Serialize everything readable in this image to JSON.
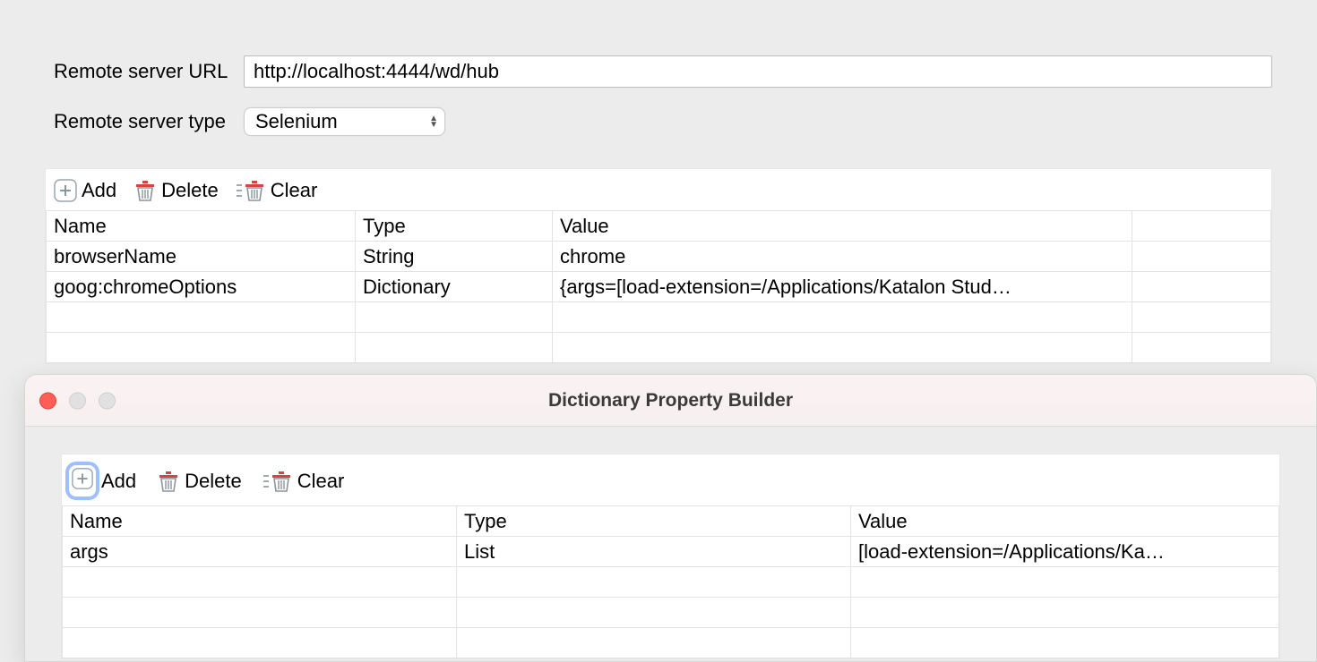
{
  "form": {
    "url_label": "Remote server URL",
    "url_value": "http://localhost:4444/wd/hub",
    "type_label": "Remote server type",
    "type_value": "Selenium"
  },
  "toolbar1": {
    "add": "Add",
    "delete": "Delete",
    "clear": "Clear"
  },
  "table1": {
    "headers": {
      "name": "Name",
      "type": "Type",
      "value": "Value"
    },
    "rows": [
      {
        "name": "browserName",
        "type": "String",
        "value": "chrome"
      },
      {
        "name": "goog:chromeOptions",
        "type": "Dictionary",
        "value": "{args=[load-extension=/Applications/Katalon Stud…"
      }
    ]
  },
  "dialog": {
    "title": "Dictionary Property Builder",
    "toolbar": {
      "add": "Add",
      "delete": "Delete",
      "clear": "Clear"
    },
    "table": {
      "headers": {
        "name": "Name",
        "type": "Type",
        "value": "Value"
      },
      "rows": [
        {
          "name": "args",
          "type": "List",
          "value": "[load-extension=/Applications/Ka…"
        }
      ]
    }
  }
}
